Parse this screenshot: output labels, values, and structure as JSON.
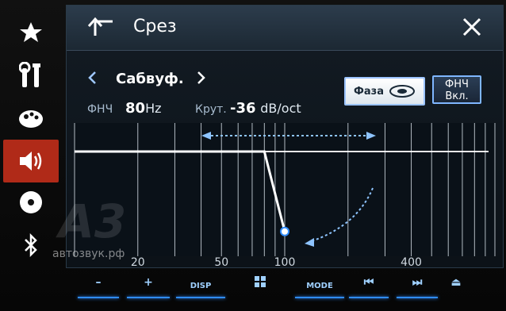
{
  "header": {
    "title": "Срез"
  },
  "sub": {
    "channel": "Сабвуф."
  },
  "filter": {
    "freq_label": "ФНЧ",
    "freq_value": "80",
    "freq_unit": "Hz",
    "slope_label": "Крут.",
    "slope_value": "-36",
    "slope_unit": "dB/oct"
  },
  "buttons": {
    "phase_label": "Фаза",
    "lpf_label_top": "ФНЧ",
    "lpf_label_bottom": "Вкл."
  },
  "chart_data": {
    "type": "line",
    "xscale": "log",
    "xticks": [
      "20",
      "50",
      "100",
      "400"
    ],
    "cutoff_hz": 80,
    "slope_db_oct": -36,
    "series": [
      {
        "x": [
          10,
          80,
          100
        ],
        "y": [
          0,
          0,
          -36
        ]
      }
    ]
  },
  "hardware": {
    "minus": "–",
    "plus": "+",
    "disp": "DISP",
    "mode": "MODE",
    "prev": "⏮",
    "next": "⏭",
    "eject": "⏏"
  },
  "watermark": {
    "logo": "A3",
    "site": "автозвук.рф"
  },
  "colors": {
    "accent": "#2f8cff",
    "active": "#b02a18"
  }
}
